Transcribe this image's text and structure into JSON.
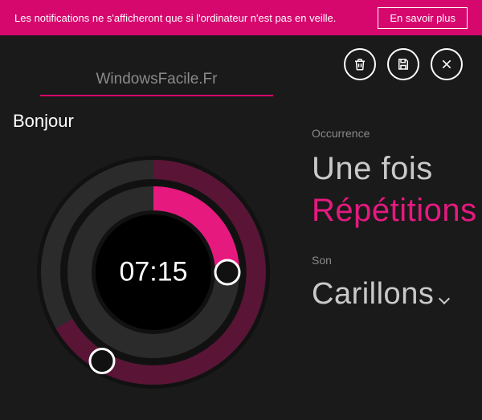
{
  "banner": {
    "text": "Les notifications ne s'afficheront que si l'ordinateur n'est pas en veille.",
    "button": "En savoir plus"
  },
  "toolbar": {
    "delete": "trash-icon",
    "save": "save-icon",
    "close": "close-icon"
  },
  "alarm": {
    "title": "WindowsFacile.Fr",
    "subtitle": "Bonjour",
    "time": "07:15"
  },
  "occurrence": {
    "label": "Occurrence",
    "options": {
      "once": "Une fois",
      "repeat": "Répétitions"
    },
    "selected": "repeat"
  },
  "sound": {
    "label": "Son",
    "value": "Carillons"
  },
  "colors": {
    "accent": "#d6076d",
    "accent_light": "#e6197f"
  }
}
